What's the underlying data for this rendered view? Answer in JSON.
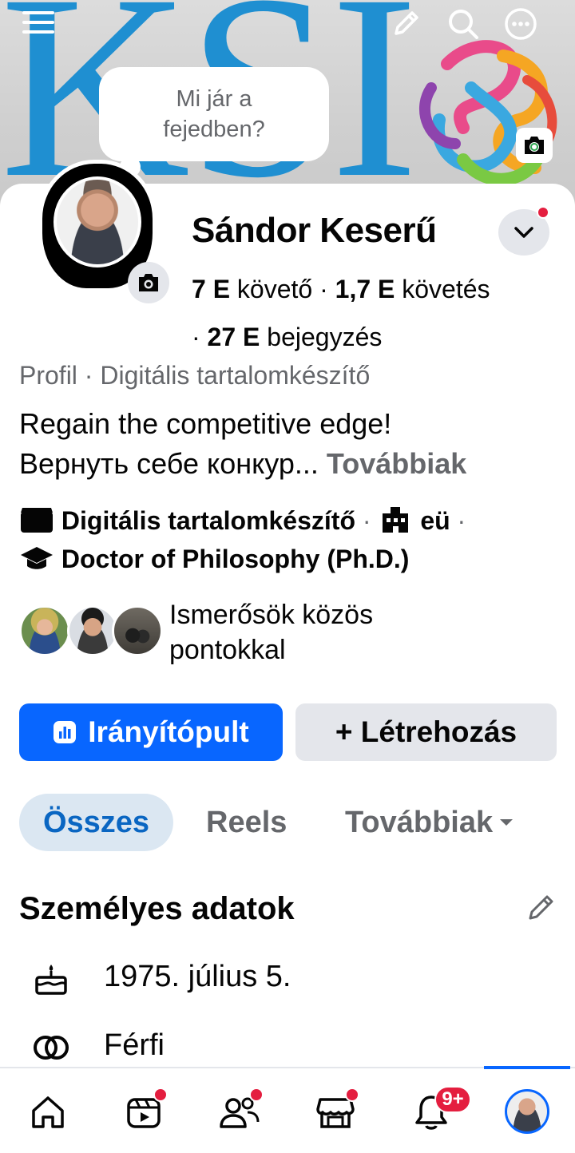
{
  "cover": {
    "text": "KSI",
    "top_icons": [
      "menu-icon",
      "edit-icon",
      "search-icon",
      "more-icon"
    ]
  },
  "composer": {
    "prompt": "Mi jár a fejedben?"
  },
  "profile": {
    "name": "Sándor Keserű",
    "followers_value": "7 E",
    "followers_label": "követő",
    "following_value": "1,7 E",
    "following_label": "követés",
    "posts_value": "27 E",
    "posts_label": "bejegyzés",
    "category": "Profil · Digitális tartalomkészítő",
    "bio_line1": "Regain the competitive edge!",
    "bio_line2": "Вернуть себе конкур...",
    "bio_more": "Továbbiak",
    "detail_creator": "Digitális tartalomkészítő",
    "detail_workplace": "eü",
    "detail_education": "Doctor of Philosophy (Ph.D.)",
    "mutual_friends_label": "Ismerősök közös pontokkal"
  },
  "buttons": {
    "dashboard": "Irányítópult",
    "create": "+ Létrehozás"
  },
  "tabs": {
    "all": "Összes",
    "reels": "Reels",
    "more": "Továbbiak"
  },
  "personal_info": {
    "title": "Személyes adatok",
    "birthday": "1975. július 5.",
    "gender": "Férfi"
  },
  "bottom_nav": {
    "notifications_badge": "9+",
    "items": [
      "home-icon",
      "video-icon",
      "friends-icon",
      "marketplace-icon",
      "notifications-icon",
      "profile-avatar"
    ]
  },
  "colors": {
    "primary": "#0866ff",
    "cover_text": "#1f8fd1",
    "badge_red": "#e41e3f",
    "secondary_text": "#65676b"
  }
}
